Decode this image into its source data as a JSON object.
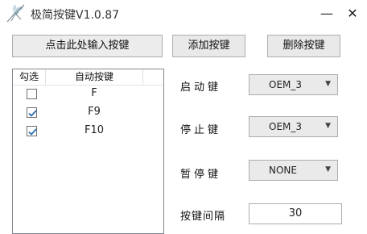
{
  "window": {
    "title": "极简按键V1.0.87",
    "minimize_label": "—",
    "close_label": "✕"
  },
  "toolbar": {
    "input_button": "点击此处输入按键",
    "add_button": "添加按键",
    "delete_button": "删除按键"
  },
  "list": {
    "headers": {
      "check": "勾选",
      "key": "自动按键"
    },
    "rows": [
      {
        "key": "F",
        "checked": false
      },
      {
        "key": "F9",
        "checked": true
      },
      {
        "key": "F10",
        "checked": true
      }
    ]
  },
  "settings": {
    "start_key": {
      "label": "启动键",
      "value": "OEM_3"
    },
    "stop_key": {
      "label": "停止键",
      "value": "OEM_3"
    },
    "pause_key": {
      "label": "暂停键",
      "value": "NONE"
    },
    "interval": {
      "label": "按键间隔",
      "value": "30"
    }
  },
  "colors": {
    "check_mark": "#2a6fb0",
    "accent": "#0078d7"
  },
  "icons": {
    "app": "mosquito-icon",
    "dropdown": "chevron-down-icon"
  }
}
